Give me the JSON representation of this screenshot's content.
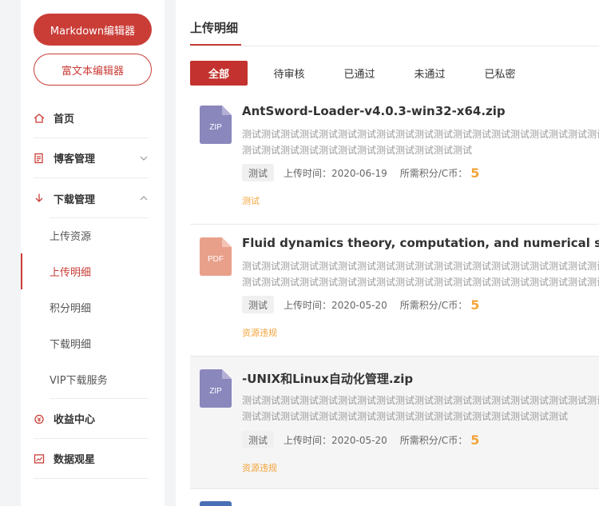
{
  "sidebar": {
    "markdown_btn": "Markdown编辑器",
    "richtext_btn": "富文本编辑器",
    "nav": [
      {
        "label": "首页"
      },
      {
        "label": "博客管理"
      },
      {
        "label": "下载管理"
      },
      {
        "label": "收益中心"
      },
      {
        "label": "数据观星"
      }
    ],
    "download_sub": [
      {
        "label": "上传资源"
      },
      {
        "label": "上传明细"
      },
      {
        "label": "积分明细"
      },
      {
        "label": "下载明细"
      },
      {
        "label": "VIP下载服务"
      }
    ]
  },
  "main": {
    "title": "上传明细",
    "tabs": [
      {
        "label": "全部"
      },
      {
        "label": "待审核"
      },
      {
        "label": "已通过"
      },
      {
        "label": "未通过"
      },
      {
        "label": "已私密"
      }
    ],
    "items": [
      {
        "file_type": "ZIP",
        "title": "AntSword-Loader-v4.0.3-win32-x64.zip",
        "desc": "测试测试测试测试测试测试测试测试测试测试测试测试测试测试测试测试测试测试测试测试测试测试测试测试测试测试测试测试测试测试测试",
        "tag": "测试",
        "upload_time": "上传时间：2020-06-19",
        "points_label": "所需积分/C币：",
        "points": "5",
        "status": "测试"
      },
      {
        "file_type": "PDF",
        "title": "Fluid dynamics theory, computation, and numerical simulation",
        "desc": "测试测试测试测试测试测试测试测试测试测试测试测试测试测试测试测试测试测试测试测试测试测试测试测试测试测试测试测试测试测试测试测试测试测试测试测试测试测试测试测试",
        "tag": "测试",
        "upload_time": "上传时间：2020-05-20",
        "points_label": "所需积分/C币：",
        "points": "5",
        "status": "资源违规"
      },
      {
        "file_type": "ZIP",
        "title": "-UNIX和Linux自动化管理.zip",
        "desc": "测试测试测试测试测试测试测试测试测试测试测试测试测试测试测试测试测试测试测试测试测试测试测试测试测试测试测试测试测试测试测试测试测试测试测试测试",
        "tag": "测试",
        "upload_time": "上传时间：2020-05-20",
        "points_label": "所需积分/C币：",
        "points": "5",
        "status": "资源违规"
      }
    ]
  },
  "colors": {
    "accent": "#ca3d37",
    "zip_icon": "#8a87bd",
    "pdf_icon": "#e9a08b",
    "points": "#f3a43b"
  }
}
